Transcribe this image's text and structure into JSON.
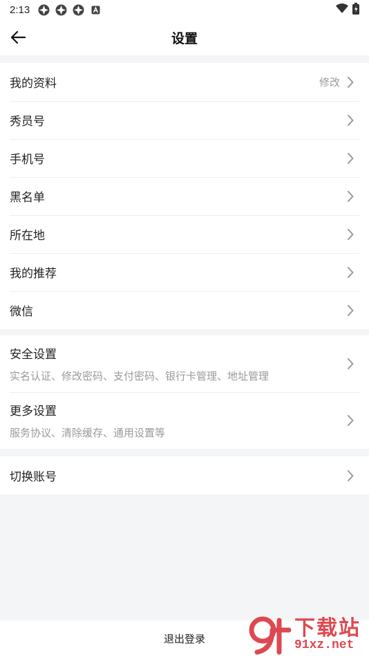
{
  "status_bar": {
    "time": "2:13"
  },
  "nav": {
    "title": "设置"
  },
  "group1": [
    {
      "label": "我的资料",
      "value": "修改"
    },
    {
      "label": "秀员号",
      "value": ""
    },
    {
      "label": "手机号",
      "value": ""
    },
    {
      "label": "黑名单",
      "value": ""
    },
    {
      "label": "所在地",
      "value": ""
    },
    {
      "label": "我的推荐",
      "value": ""
    },
    {
      "label": "微信",
      "value": ""
    }
  ],
  "group2": [
    {
      "label": "安全设置",
      "sub": "实名认证、修改密码、支付密码、银行卡管理、地址管理"
    },
    {
      "label": "更多设置",
      "sub": "服务协议、清除缓存、通用设置等"
    }
  ],
  "group3": [
    {
      "label": "切换账号"
    }
  ],
  "footer": {
    "logout_label": "退出登录"
  },
  "watermark": {
    "top": "下载站",
    "bottom": "91xz.net",
    "logo": "9f"
  },
  "colors": {
    "background": "#f4f5f7",
    "card": "#ffffff",
    "muted_text": "#9a9a9a",
    "watermark": "#d82a33"
  }
}
